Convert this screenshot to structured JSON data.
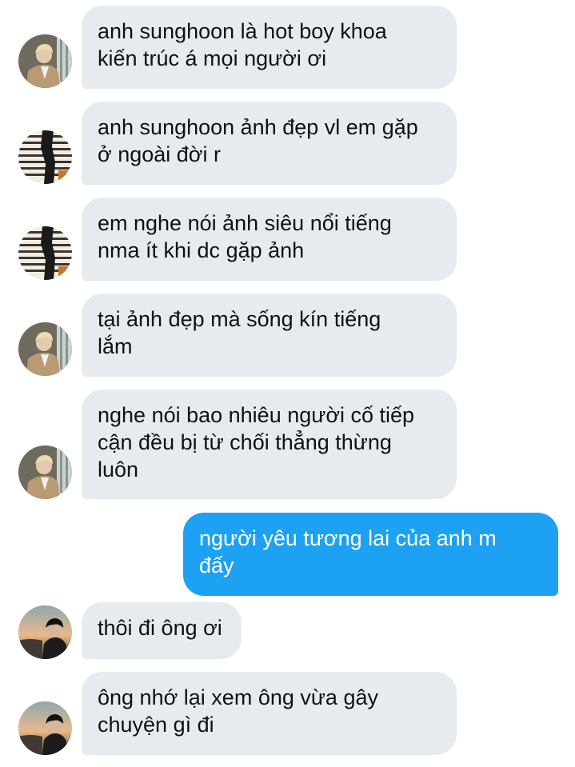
{
  "conversation": {
    "messages": [
      {
        "sender": "other",
        "avatar": "blonde-boy-avatar",
        "text": "anh sunghoon là hot boy khoa\nkiến trúc á mọi người ơi"
      },
      {
        "sender": "other",
        "avatar": "silhouette-window-avatar",
        "text": "anh sunghoon ảnh đẹp vl em gặp\nở ngoài đời r"
      },
      {
        "sender": "other",
        "avatar": "silhouette-window-avatar",
        "text": "em nghe nói ảnh siêu nổi tiếng\nnma ít khi dc gặp ảnh"
      },
      {
        "sender": "other",
        "avatar": "blonde-boy-avatar",
        "text": "tại ảnh đẹp mà sống kín tiếng\nlắm"
      },
      {
        "sender": "other",
        "avatar": "blonde-boy-avatar",
        "text": "nghe nói bao nhiêu người cố tiếp\ncận đều bị từ chối thẳng thừng\nluôn"
      },
      {
        "sender": "self",
        "text": "người yêu tương lai của anh m\nđấy"
      },
      {
        "sender": "other",
        "avatar": "sunset-portrait-avatar",
        "text": "thôi đi ông ơi"
      },
      {
        "sender": "other",
        "avatar": "sunset-portrait-avatar",
        "text": "ông nhớ lại xem ông vừa gây\nchuyện gì đi"
      }
    ]
  },
  "colors": {
    "incoming_bubble": "#e6ebef",
    "outgoing_bubble": "#1da1f2",
    "incoming_text": "#111111",
    "outgoing_text": "#ffffff"
  }
}
